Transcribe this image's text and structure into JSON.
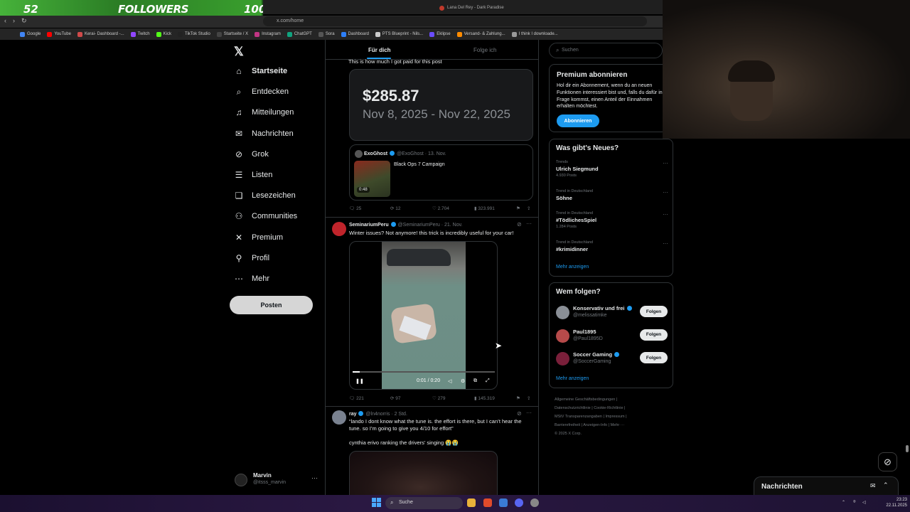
{
  "banner": {
    "count": "52",
    "label": "FOLLOWERS",
    "goal": "100"
  },
  "browser": {
    "tab_title": "Lana Del Rey - Dark Paradise",
    "address": "x.com/home",
    "bookmarks": [
      "Google",
      "YouTube",
      "Kerai- Dashboard -...",
      "Twitch",
      "Kick",
      "TikTok Studio",
      "Startseite / X",
      "Instagram",
      "ChatGPT",
      "Sora",
      "Dashboard",
      "PTS Blueprint - Nils...",
      "Eklipse",
      "Versand- & Zahlung...",
      "I think I downloade..."
    ]
  },
  "nav": {
    "items": [
      {
        "label": "Startseite",
        "icon": "home-icon",
        "glyph": "⌂"
      },
      {
        "label": "Entdecken",
        "icon": "search-icon",
        "glyph": "⌕"
      },
      {
        "label": "Mitteilungen",
        "icon": "bell-icon",
        "glyph": "♫"
      },
      {
        "label": "Nachrichten",
        "icon": "mail-icon",
        "glyph": "✉"
      },
      {
        "label": "Grok",
        "icon": "grok-icon",
        "glyph": "⊘"
      },
      {
        "label": "Listen",
        "icon": "list-icon",
        "glyph": "☰"
      },
      {
        "label": "Lesezeichen",
        "icon": "bookmark-icon",
        "glyph": "❏"
      },
      {
        "label": "Communities",
        "icon": "communities-icon",
        "glyph": "⚇"
      },
      {
        "label": "Premium",
        "icon": "x-premium-icon",
        "glyph": "✕"
      },
      {
        "label": "Profil",
        "icon": "profile-icon",
        "glyph": "⚲"
      },
      {
        "label": "Mehr",
        "icon": "more-icon",
        "glyph": "⋯"
      }
    ],
    "post_button": "Posten",
    "profile": {
      "name": "Marvin",
      "handle": "@itsss_marvin"
    }
  },
  "feed": {
    "tabs": [
      "Für dich",
      "Folge ich"
    ],
    "post1": {
      "text": "This is how much I got paid for this post",
      "amount": "$285.87",
      "range": "Nov 8, 2025 - Nov 22, 2025",
      "quote": {
        "name": "ExoGhost",
        "meta": "@ExoGhost · 13. Nov.",
        "title": "Black Ops 7 Campaign",
        "duration": "0:48"
      },
      "stats": {
        "replies": "25",
        "reposts": "12",
        "likes": "2.704",
        "views": "323.991"
      }
    },
    "post2": {
      "name": "SeminariumPeru",
      "meta": "@SeminariumPeru · 21. Nov.",
      "text": "Winter issues? Not anymore! this trick is incredibly useful for your car!",
      "video_time": "0:01 / 0:20",
      "stats": {
        "replies": "221",
        "reposts": "97",
        "likes": "279",
        "views": "145.319"
      }
    },
    "post3": {
      "name": "ray",
      "meta": "@ln4norris · 2 Std.",
      "text": "“lando I dont know what the tune is. the effort is there, but I can’t hear the tune. so I’m going to give you 4/10 for effort”",
      "text2": "cynthia erivo ranking the drivers’ singing 😭😭"
    }
  },
  "sidebar": {
    "search_placeholder": "Suchen",
    "premium": {
      "title": "Premium abonnieren",
      "text": "Hol dir ein Abonnement, wenn du an neuen Funktionen interessiert bist und, falls du dafür in Frage kommst, einen Anteil der Einnahmen erhalten möchtest.",
      "button": "Abonnieren"
    },
    "news": {
      "title": "Was gibt’s Neues?",
      "trends": [
        {
          "context": "Trends",
          "topic": "Ulrich Siegmund",
          "count": "4.930 Posts"
        },
        {
          "context": "Trend in Deutschland",
          "topic": "Söhne",
          "count": ""
        },
        {
          "context": "Trend in Deutschland",
          "topic": "#TödlichesSpiel",
          "count": "1.284 Posts"
        },
        {
          "context": "Trend in Deutschland",
          "topic": "#krimidinner",
          "count": ""
        }
      ],
      "more": "Mehr anzeigen"
    },
    "follow": {
      "title": "Wem folgen?",
      "users": [
        {
          "name": "Konservativ und frei",
          "handle": "@melissatimke",
          "button": "Folgen"
        },
        {
          "name": "Paul1895",
          "handle": "@Paul1895D",
          "button": "Folgen"
        },
        {
          "name": "Soccer Gaming",
          "handle": "@SoccerGaming",
          "button": "Folgen"
        }
      ],
      "more": "Mehr anzeigen"
    },
    "footer": [
      "Allgemeine Geschäftsbedingungen |",
      "Datenschutzrichtlinie | Cookie-Richtlinie |",
      "MStV Transparenzangaben | Impressum |",
      "Barrierefreiheit | Anzeigen-Info | Mehr ···",
      "© 2025 X Corp."
    ]
  },
  "dm": {
    "label": "Nachrichten"
  },
  "taskbar": {
    "search": "Suche",
    "time": "23:23",
    "date": "22.11.2025"
  },
  "colors": {
    "accent": "#1d9bf0",
    "banner": "#46b23a"
  }
}
